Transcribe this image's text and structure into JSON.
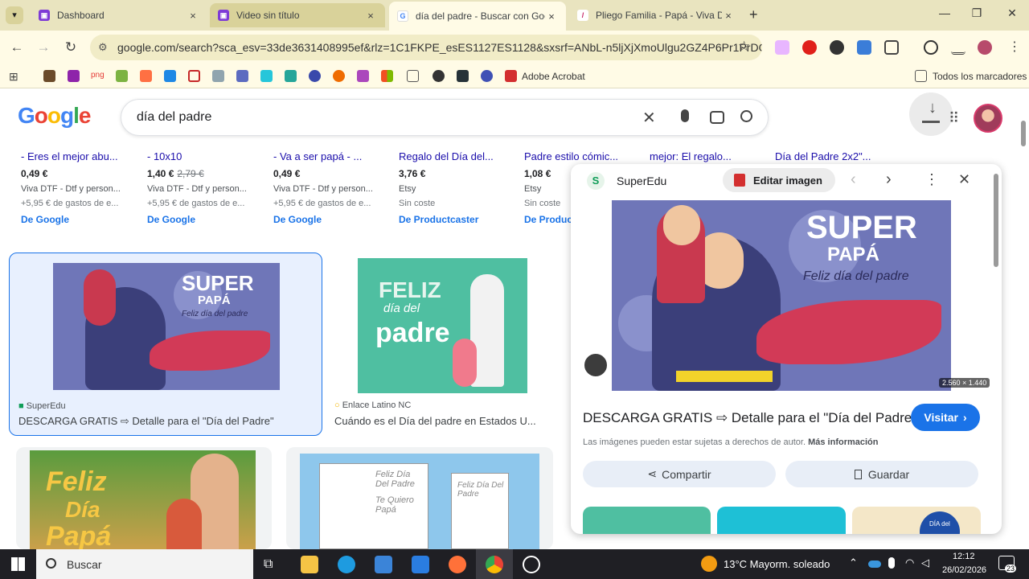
{
  "tabs": [
    {
      "title": "Dashboard",
      "close": "×"
    },
    {
      "title": "Video sin título",
      "close": "×"
    },
    {
      "title": "día del padre - Buscar con Google",
      "close": "×"
    },
    {
      "title": "Pliego Familia - Papá - Viva DTF",
      "close": "×"
    }
  ],
  "new_tab": "+",
  "url": "google.com/search?sca_esv=33de3631408995ef&rlz=1C1FKPE_esES1127ES1128&sxsrf=ANbL-n5ljXjXmoUlgu2GZ4P6Pr1PrDOeK...",
  "bookmarks": {
    "png_label": "png",
    "adobe": "Adobe Acrobat",
    "all": "Todos los marcadores"
  },
  "search": {
    "query": "día del padre"
  },
  "shopping": [
    {
      "title": "- Eres el mejor abu...",
      "price": "0,49 €",
      "old": "",
      "seller": "Viva DTF - Dtf y person...",
      "ship": "+5,95 € de gastos de e...",
      "source": "De Google"
    },
    {
      "title": "- 10x10",
      "price": "1,40 €",
      "old": "2,79 €",
      "seller": "Viva DTF - Dtf y person...",
      "ship": "+5,95 € de gastos de e...",
      "source": "De Google"
    },
    {
      "title": "- Va a ser papá - ...",
      "price": "0,49 €",
      "old": "",
      "seller": "Viva DTF - Dtf y person...",
      "ship": "+5,95 € de gastos de e...",
      "source": "De Google"
    },
    {
      "title": "Regalo del Día del...",
      "price": "3,76 €",
      "old": "",
      "seller": "Etsy",
      "ship": "Sin coste",
      "source": "De Productcaster"
    },
    {
      "title": "Padre estilo cómic...",
      "price": "1,08 €",
      "old": "",
      "seller": "Etsy",
      "ship": "Sin coste",
      "source": "De Productcaster"
    },
    {
      "title": "mejor: El regalo...",
      "price": "",
      "old": "",
      "seller": "",
      "ship": "",
      "source": ""
    },
    {
      "title": "Día del Padre 2x2\"...",
      "price": "",
      "old": "",
      "seller": "",
      "ship": "",
      "source": ""
    }
  ],
  "results": [
    {
      "source": "SuperEdu",
      "title": "DESCARGA GRATIS ⇨ Detalle para el \"Día del Padre\""
    },
    {
      "source": "Enlace Latino NC",
      "title": "Cuándo es el Día del padre en Estados U..."
    }
  ],
  "artwork": {
    "super": "SUPER",
    "papa": "PAPÁ",
    "feliz_sub": "Feliz día del padre",
    "feliz": "FELIZ",
    "dia_del": "día del",
    "padre": "padre",
    "feliz2": "Feliz",
    "dia": "Día",
    "papa2": "Papá",
    "coloring1": "Feliz Día Del Padre",
    "coloring2": "Te Quiero Papá",
    "coloring3": "Feliz Día Del Padre",
    "strip_dia": "DÍA del"
  },
  "panel": {
    "source": "SuperEdu",
    "edit": "Editar imagen",
    "dims": "2.560 × 1.440",
    "title": "DESCARGA GRATIS ⇨ Detalle para el \"Día del Padre\"",
    "visit": "Visitar",
    "rights": "Las imágenes pueden estar sujetas a derechos de autor.",
    "more": "Más información",
    "share": "Compartir",
    "save": "Guardar"
  },
  "taskbar": {
    "search": "Buscar",
    "weather": "13°C  Mayorm. soleado",
    "time": "12:12",
    "date": "26/02/2026",
    "notif": "23"
  }
}
